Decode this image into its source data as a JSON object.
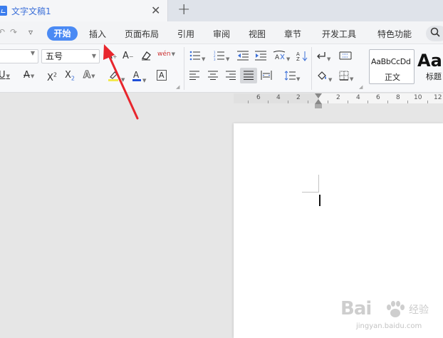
{
  "tabbar": {
    "doc_title": "文字文稿1",
    "close_glyph": "✕",
    "add_glyph": "+"
  },
  "quick_access": {
    "undo_glyph": "↶",
    "redo_glyph": "↷",
    "more_glyph": "▿"
  },
  "menu": {
    "active": "开始",
    "items": [
      "插入",
      "页面布局",
      "引用",
      "审阅",
      "视图",
      "章节",
      "开发工具",
      "特色功能"
    ],
    "search_glyph": "🔍"
  },
  "ribbon": {
    "font_size_value": "五号",
    "grow_font": "A",
    "shrink_font": "A",
    "pinyin_label": "wén",
    "styles": [
      {
        "sample": "AaBbCcDd",
        "name": "正文"
      },
      {
        "sample": "AaI",
        "name": "标题"
      }
    ]
  },
  "ruler": {
    "labels": [
      "6",
      "4",
      "2",
      "2",
      "4",
      "6",
      "8",
      "10",
      "12"
    ]
  },
  "watermark": {
    "brand": "Bai",
    "brand2": "经验",
    "url": "jingyan.baidu.com"
  },
  "colors": {
    "accent": "#4a8af4",
    "annotation_arrow": "#e8262d",
    "font_color_bar": "#1f4fd8"
  }
}
